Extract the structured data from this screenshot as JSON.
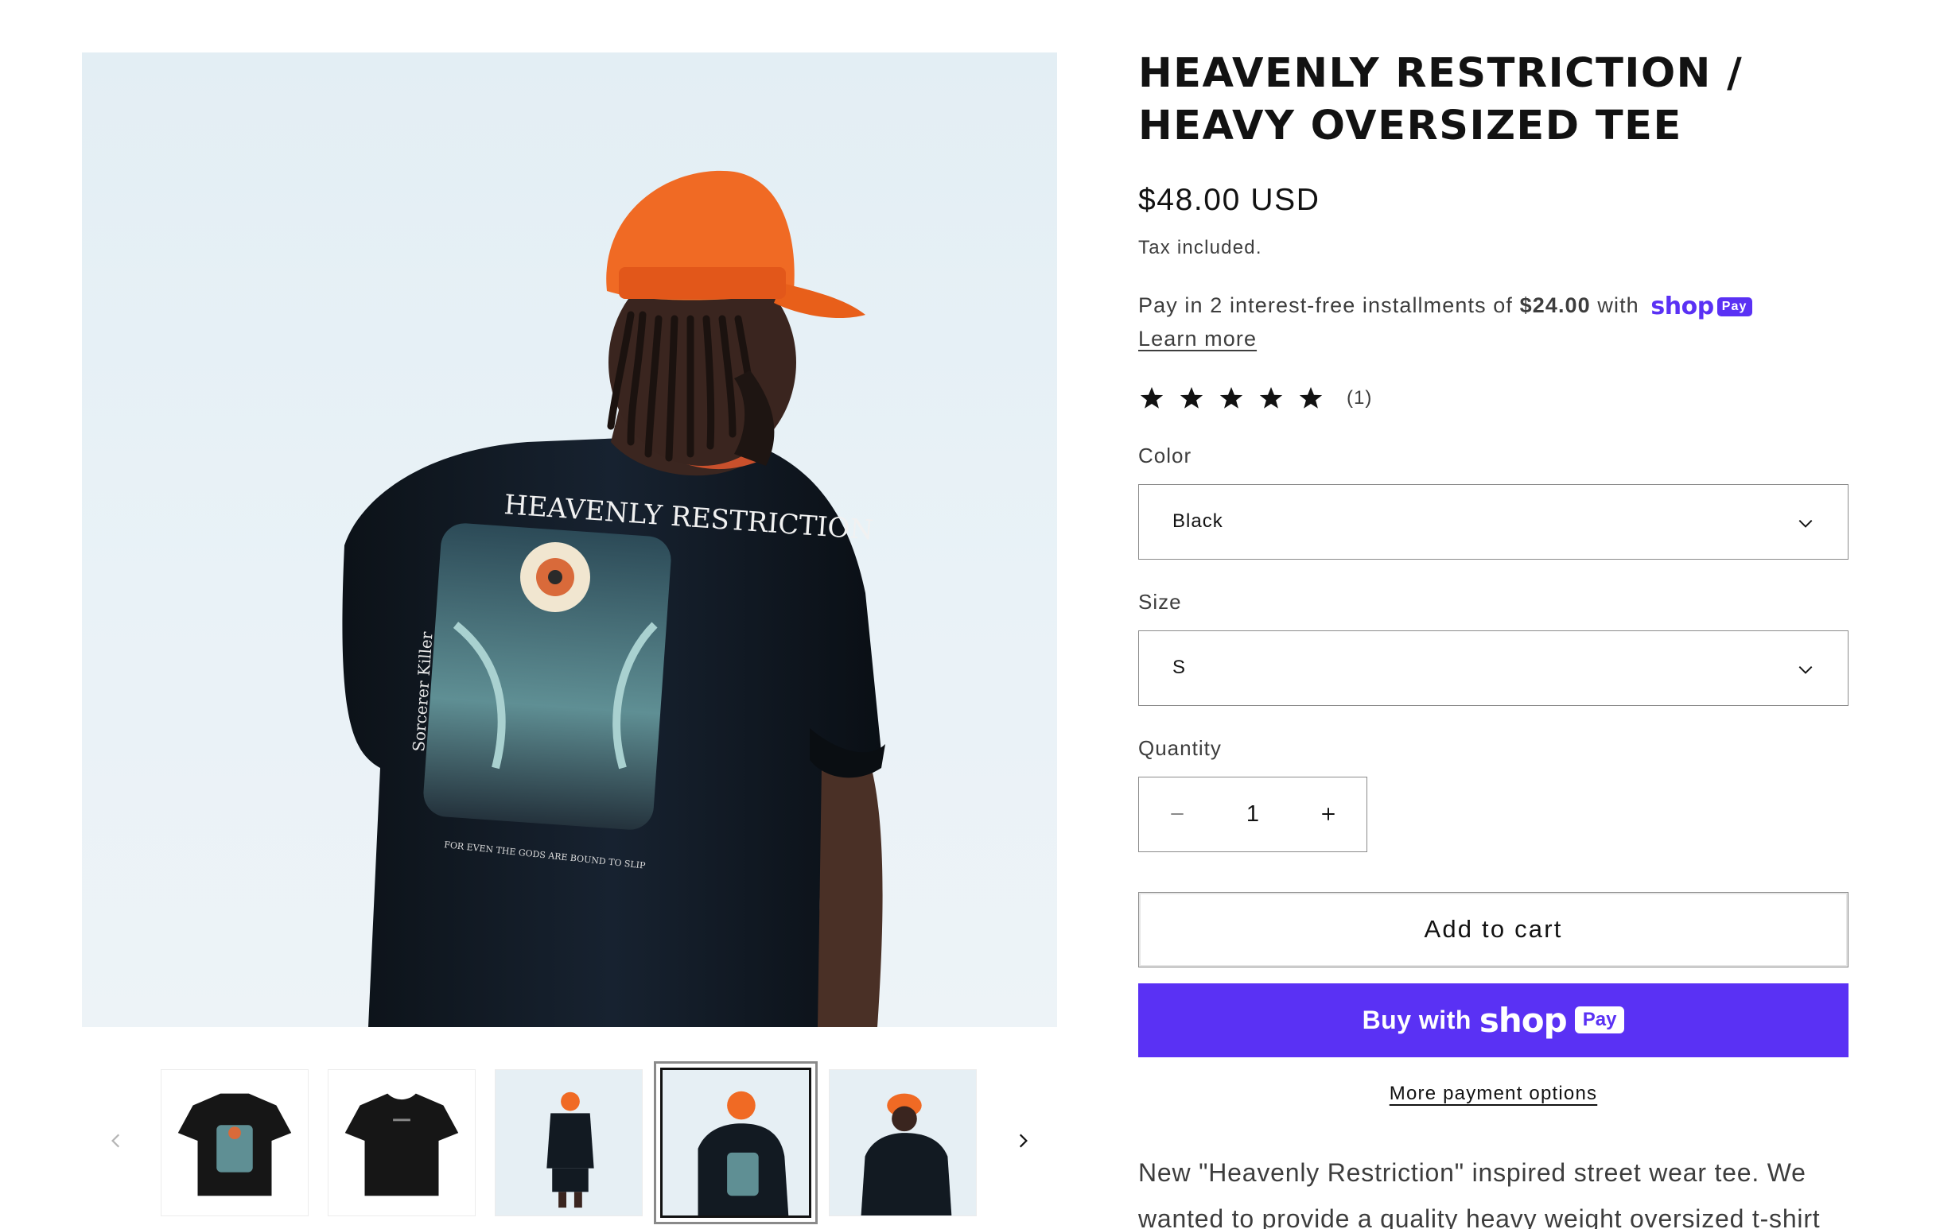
{
  "product": {
    "title": "HEAVENLY RESTRICTION / HEAVY OVERSIZED TEE",
    "price": "$48.00 USD",
    "tax_note": "Tax included.",
    "installments": {
      "prefix": "Pay in 2 interest-free installments of ",
      "amount": "$24.00",
      "suffix": " with ",
      "brand_word": "shop",
      "brand_badge": "Pay",
      "learn_more": "Learn more"
    },
    "rating": {
      "stars": 5,
      "max": 5,
      "count_label": "(1)"
    },
    "color": {
      "label": "Color",
      "selected": "Black"
    },
    "size": {
      "label": "Size",
      "selected": "S"
    },
    "quantity": {
      "label": "Quantity",
      "value": "1"
    },
    "add_to_cart": "Add to cart",
    "buy_now": {
      "prefix": "Buy with",
      "brand_word": "shop",
      "brand_badge": "Pay"
    },
    "more_payment": "More payment options",
    "description": "New \"Heavenly Restriction\" inspired street wear tee. We wanted to provide a quality heavy weight oversized t-shirt"
  },
  "gallery": {
    "print_text": "HEAVENLY RESTRICTION",
    "print_side_text": "Sorcerer Killer",
    "print_caption": "FOR EVEN THE GODS ARE BOUND TO SLIP",
    "active_thumb": 4,
    "thumbs": [
      {
        "name": "tee-back-flat"
      },
      {
        "name": "tee-front-flat"
      },
      {
        "name": "model-full-back"
      },
      {
        "name": "model-back-closeup"
      },
      {
        "name": "model-front"
      }
    ]
  },
  "colors": {
    "shop_purple": "#5a31f4",
    "text": "#121212",
    "border": "#8a8a8a",
    "cap_orange": "#f06a24",
    "shirt": "#111820"
  }
}
